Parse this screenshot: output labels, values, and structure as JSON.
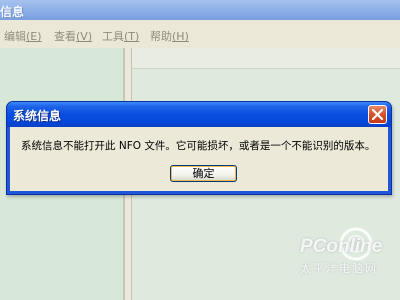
{
  "app": {
    "title": "信息"
  },
  "menu": {
    "items": [
      {
        "label": "编辑",
        "mnemonic": "(E)"
      },
      {
        "label": "查看",
        "mnemonic": "(V)"
      },
      {
        "label": "工具",
        "mnemonic": "(T)"
      },
      {
        "label": "帮助",
        "mnemonic": "(H)"
      }
    ]
  },
  "dialog": {
    "title": "系统信息",
    "message": "系统信息不能打开此 NFO 文件。它可能损坏，或者是一个不能识别的版本。",
    "ok_label": "确定",
    "close_icon": "close-icon"
  },
  "watermark": {
    "brand": "PConline",
    "sub": "太平洋电脑网"
  },
  "colors": {
    "dialog_title_blue": "#0a4ee0",
    "close_red": "#d7542e",
    "pane_green": "#dfeadf",
    "dialog_face": "#ece9d8"
  }
}
